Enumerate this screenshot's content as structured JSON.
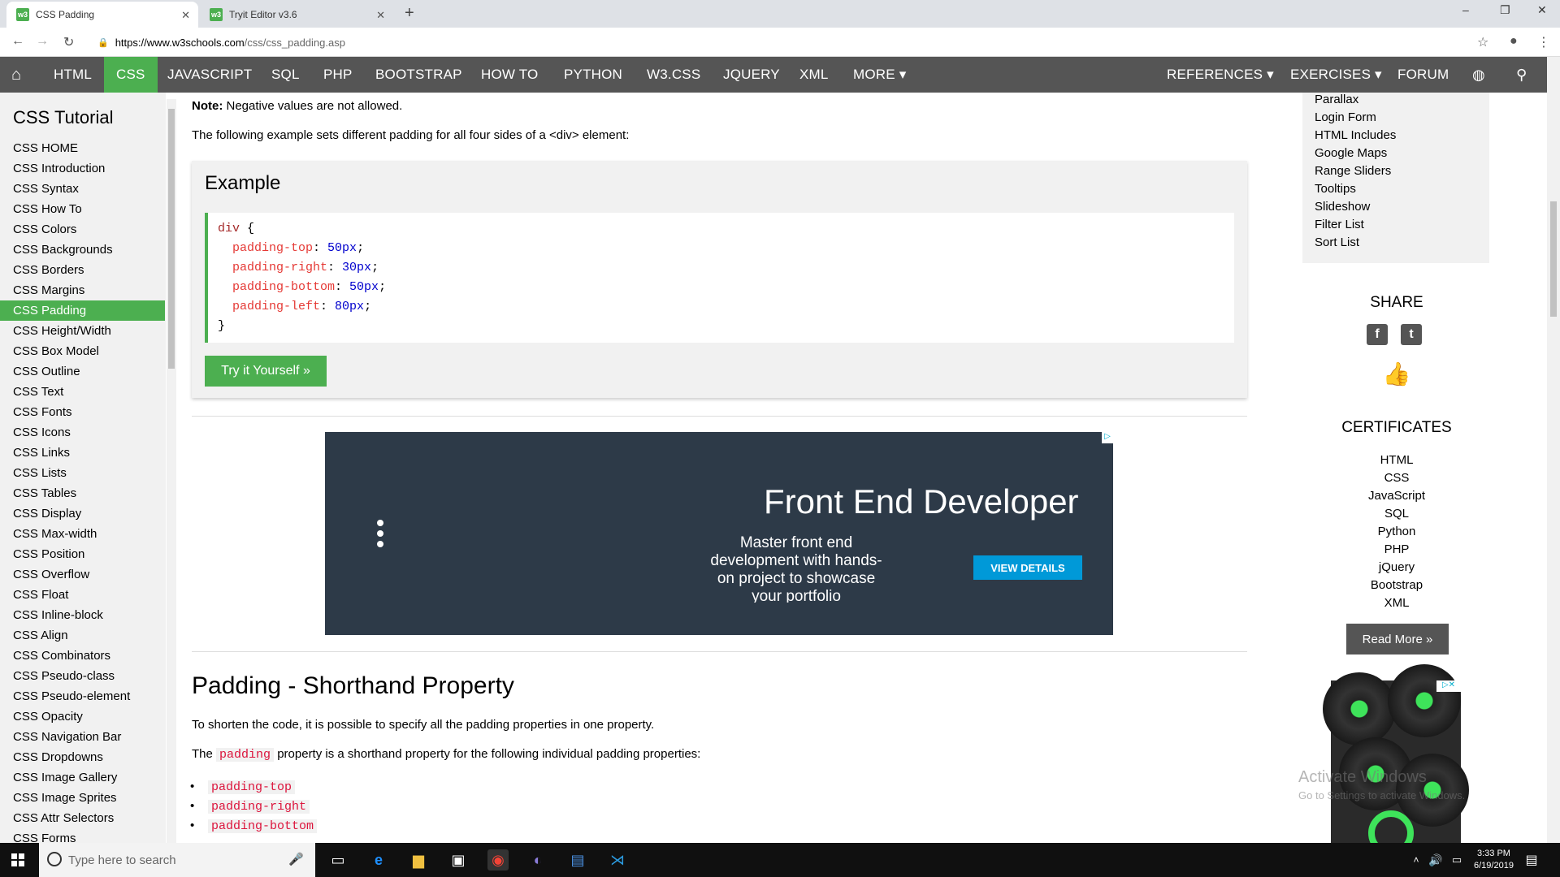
{
  "browser": {
    "tabs": [
      {
        "label": "CSS Padding",
        "active": true
      },
      {
        "label": "Tryit Editor v3.6",
        "active": false
      }
    ],
    "url_domain": "https://www.w3schools.com",
    "url_path": "/css/css_padding.asp",
    "new_tab": "+",
    "minimize": "–",
    "maximize": "❐",
    "close": "✕"
  },
  "topnav": {
    "items": [
      "HTML",
      "CSS",
      "JAVASCRIPT",
      "SQL",
      "PHP",
      "BOOTSTRAP",
      "HOW TO",
      "PYTHON",
      "W3.CSS",
      "JQUERY",
      "XML",
      "MORE ▾"
    ],
    "right_items": [
      "REFERENCES ▾",
      "EXERCISES ▾",
      "FORUM"
    ],
    "active": "CSS"
  },
  "sidebar": {
    "title": "CSS Tutorial",
    "items": [
      "CSS HOME",
      "CSS Introduction",
      "CSS Syntax",
      "CSS How To",
      "CSS Colors",
      "CSS Backgrounds",
      "CSS Borders",
      "CSS Margins",
      "CSS Padding",
      "CSS Height/Width",
      "CSS Box Model",
      "CSS Outline",
      "CSS Text",
      "CSS Fonts",
      "CSS Icons",
      "CSS Links",
      "CSS Lists",
      "CSS Tables",
      "CSS Display",
      "CSS Max-width",
      "CSS Position",
      "CSS Overflow",
      "CSS Float",
      "CSS Inline-block",
      "CSS Align",
      "CSS Combinators",
      "CSS Pseudo-class",
      "CSS Pseudo-element",
      "CSS Opacity",
      "CSS Navigation Bar",
      "CSS Dropdowns",
      "CSS Image Gallery",
      "CSS Image Sprites",
      "CSS Attr Selectors",
      "CSS Forms"
    ],
    "active": "CSS Padding"
  },
  "main": {
    "note_label": "Note:",
    "note_text": " Negative values are not allowed.",
    "intro": "The following example sets different padding for all four sides of a <div> element:",
    "example_title": "Example",
    "code": {
      "selector": "div",
      "open": " {",
      "close": "}",
      "lines": [
        {
          "prop": "padding-top",
          "val": "50px"
        },
        {
          "prop": "padding-right",
          "val": "30px"
        },
        {
          "prop": "padding-bottom",
          "val": "50px"
        },
        {
          "prop": "padding-left",
          "val": "80px"
        }
      ]
    },
    "try_button": "Try it Yourself »",
    "ad": {
      "heading": "Front End Developer",
      "sub": "Master front end development with hands-on project to showcase your portfolio",
      "cta": "VIEW DETAILS"
    },
    "section_heading": "Padding - Shorthand Property",
    "p1": "To shorten the code, it is possible to specify all the padding properties in one property.",
    "p2_a": "The ",
    "p2_code": "padding",
    "p2_b": " property is a shorthand property for the following individual padding properties:",
    "list": [
      "padding-top",
      "padding-right",
      "padding-bottom"
    ]
  },
  "right": {
    "links": [
      "Parallax",
      "Login Form",
      "HTML Includes",
      "Google Maps",
      "Range Sliders",
      "Tooltips",
      "Slideshow",
      "Filter List",
      "Sort List"
    ],
    "share_title": "SHARE",
    "cert_title": "CERTIFICATES",
    "certs": [
      "HTML",
      "CSS",
      "JavaScript",
      "SQL",
      "Python",
      "PHP",
      "jQuery",
      "Bootstrap",
      "XML"
    ],
    "read_more": "Read More »"
  },
  "watermark": {
    "line1": "Activate Windows",
    "line2": "Go to Settings to activate Windows."
  },
  "taskbar": {
    "search_placeholder": "Type here to search",
    "time": "3:33 PM",
    "date": "6/19/2019"
  }
}
